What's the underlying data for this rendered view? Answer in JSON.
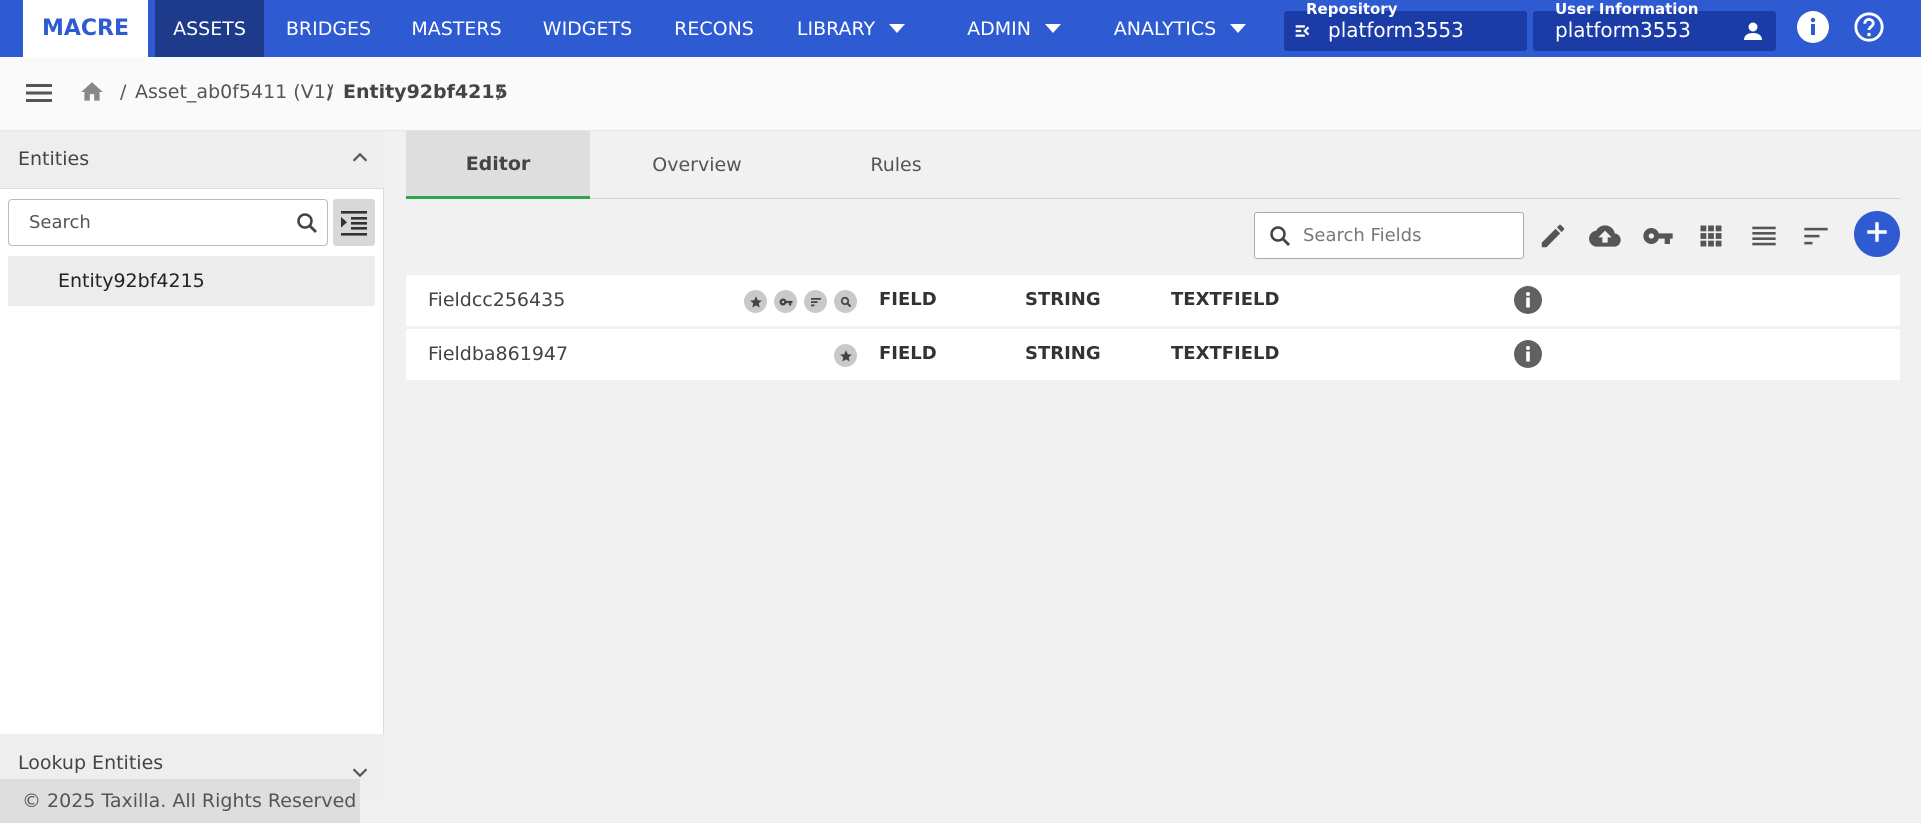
{
  "header": {
    "logo": "MACRE",
    "nav": [
      {
        "label": "ASSETS",
        "active": true
      },
      {
        "label": "BRIDGES"
      },
      {
        "label": "MASTERS"
      },
      {
        "label": "WIDGETS"
      },
      {
        "label": "RECONS"
      },
      {
        "label": "LIBRARY",
        "dropdown": true
      },
      {
        "label": "ADMIN",
        "dropdown": true
      },
      {
        "label": "ANALYTICS",
        "dropdown": true
      }
    ],
    "repository": {
      "label": "Repository",
      "value": "platform3553",
      "icon": "repository-switch-icon"
    },
    "user": {
      "label": "User Information",
      "value": "platform3553",
      "icon": "person-icon"
    },
    "info_icon": "info-icon",
    "help_icon": "help-icon"
  },
  "breadcrumb": {
    "menu_icon": "hamburger-menu-icon",
    "home_icon": "home-icon",
    "separator": "/",
    "asset": "Asset_ab0f5411 (V1)",
    "entity": "Entity92bf4215"
  },
  "left_panel": {
    "title": "Entities",
    "search_placeholder": "Search",
    "entities": [
      "Entity92bf4215"
    ],
    "lookup_title": "Lookup Entities"
  },
  "footer": {
    "text": "© 2025 Taxilla. All Rights Reserved"
  },
  "tabs": [
    {
      "label": "Editor",
      "active": true
    },
    {
      "label": "Overview"
    },
    {
      "label": "Rules"
    }
  ],
  "toolbar": {
    "search_placeholder": "Search Fields",
    "icons": [
      "edit-icon",
      "cloud-upload-icon",
      "key-icon",
      "grid-view-icon",
      "list-view-icon",
      "sort-icon",
      "add-icon"
    ]
  },
  "fields": [
    {
      "name": "Fieldcc256435",
      "badges": [
        "star-icon",
        "key-icon",
        "sort-icon",
        "search-icon"
      ],
      "kind": "FIELD",
      "type": "STRING",
      "ui": "TEXTFIELD"
    },
    {
      "name": "Fieldba861947",
      "badges": [
        "star-icon"
      ],
      "kind": "FIELD",
      "type": "STRING",
      "ui": "TEXTFIELD"
    }
  ],
  "colors": {
    "primary": "#2e5ad2",
    "active_nav": "#1e3a8a",
    "tab_underline": "#33a14a"
  }
}
